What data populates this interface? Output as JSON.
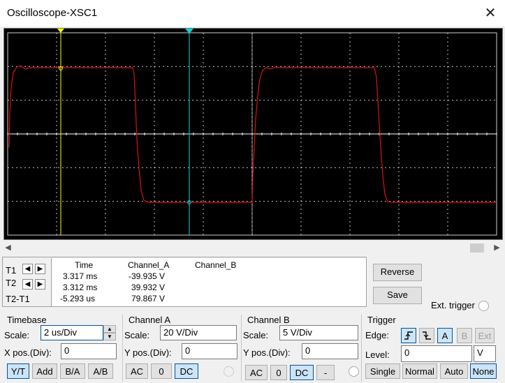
{
  "window": {
    "title": "Oscilloscope-XSC1",
    "close_glyph": "✕"
  },
  "colors": {
    "trace": "#e01010",
    "cursor1": "#ffff00",
    "cursor2": "#00d8e0",
    "grid": "#ffffff",
    "screen_bg": "#000000",
    "active_btn": "#cce4f7"
  },
  "cursors": {
    "t1_label": "T1",
    "t2_label": "T2",
    "diff_label": "T2-T1",
    "headers": {
      "time": "Time",
      "channel_a": "Channel_A",
      "channel_b": "Channel_B"
    },
    "rows": [
      {
        "time": "3.317 ms",
        "channel_a": "-39.935 V",
        "channel_b": ""
      },
      {
        "time": "3.312 ms",
        "channel_a": "39.932 V",
        "channel_b": ""
      },
      {
        "time": "-5.293 us",
        "channel_a": "79.867 V",
        "channel_b": ""
      }
    ]
  },
  "actions": {
    "reverse": "Reverse",
    "save": "Save",
    "ext_trigger": "Ext. trigger"
  },
  "timebase": {
    "title": "Timebase",
    "scale_label": "Scale:",
    "scale_value": "2 us/Div",
    "xpos_label": "X pos.(Div):",
    "xpos_value": "0",
    "modes": [
      "Y/T",
      "Add",
      "B/A",
      "A/B"
    ],
    "active_mode": "Y/T"
  },
  "channel_a": {
    "title": "Channel A",
    "scale_label": "Scale:",
    "scale_value": "20  V/Div",
    "ypos_label": "Y pos.(Div):",
    "ypos_value": "0",
    "coupling": [
      "AC",
      "0",
      "DC"
    ],
    "active_coupling": "DC"
  },
  "channel_b": {
    "title": "Channel B",
    "scale_label": "Scale:",
    "scale_value": "5  V/Div",
    "ypos_label": "Y pos.(Div):",
    "ypos_value": "0",
    "coupling": [
      "AC",
      "0",
      "DC",
      "-"
    ],
    "active_coupling": "DC"
  },
  "trigger": {
    "title": "Trigger",
    "edge_label": "Edge:",
    "edge_rising_icon": "rising-edge-icon",
    "edge_falling_icon": "falling-edge-icon",
    "sources": [
      "A",
      "B",
      "Ext"
    ],
    "active_source": "A",
    "level_label": "Level:",
    "level_value": "0",
    "level_unit": "V",
    "modes": [
      "Single",
      "Normal",
      "Auto",
      "None"
    ],
    "active_mode": "None"
  }
}
